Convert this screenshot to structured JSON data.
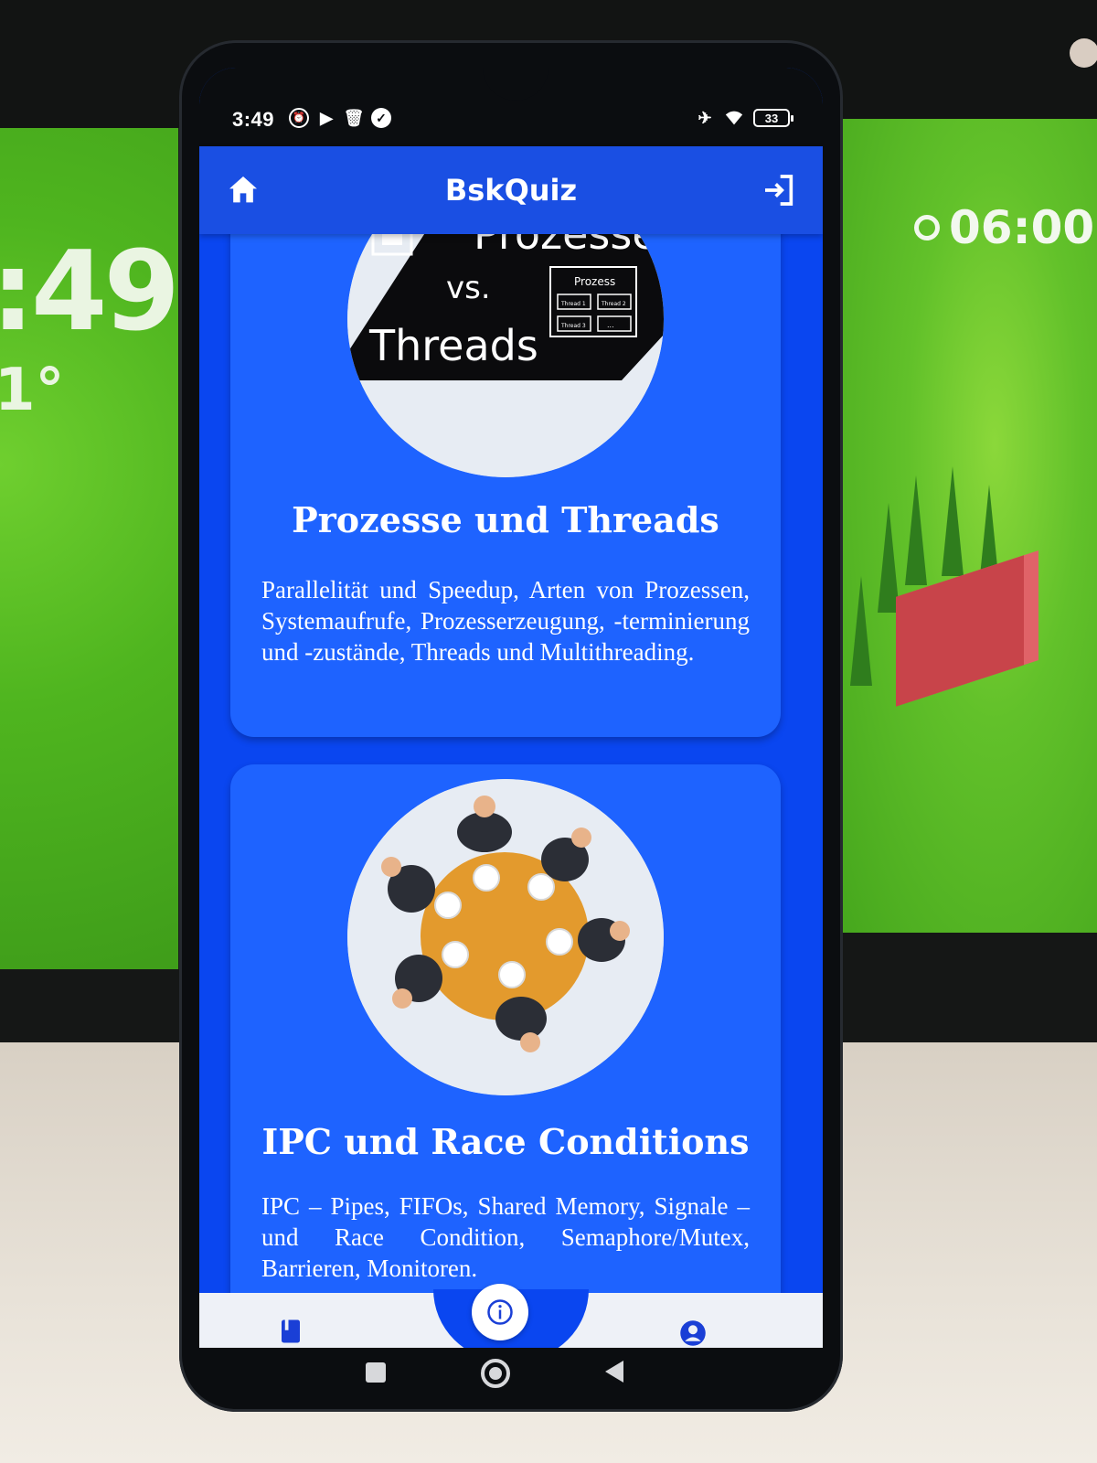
{
  "background": {
    "left_clock": ":49",
    "left_temperature": "1°",
    "right_alarm_time": "06:00"
  },
  "status_bar": {
    "time": "3:49",
    "battery_level": "33",
    "left_icons": [
      "alarm-icon",
      "play-store-icon",
      "trash-icon",
      "check-circle-icon"
    ],
    "right_icons": [
      "airplane-mode-icon",
      "wifi-icon",
      "battery-icon"
    ]
  },
  "app_bar": {
    "title": "BskQuiz",
    "left_icon": "home-icon",
    "right_icon": "logout-icon"
  },
  "cards": [
    {
      "title": "Prozesse und Threads",
      "description": "Parallelität und Speedup, Arten von Prozessen, Systemaufrufe, Prozesserzeugung, -terminierung und -zustände, Threads und Multithreading.",
      "image": {
        "heading": "Prozesse",
        "vs": "vs.",
        "subheading": "Threads",
        "box_title": "Prozess",
        "box_cells": [
          "Thread 1",
          "Thread 2",
          "Thread 3",
          "..."
        ]
      }
    },
    {
      "title": "IPC und Race Conditions",
      "description": "IPC – Pipes, FIFOs, Shared Memory, Signale – und Race Condition, Semaphore/Mutex, Barrieren, Monitoren.",
      "image": {
        "subject": "dining-philosophers-illustration"
      }
    }
  ],
  "bottom_nav": {
    "items": [
      "book-icon",
      "info-icon",
      "person-icon"
    ]
  },
  "system_nav": {
    "items": [
      "recents-square-icon",
      "home-circle-icon",
      "back-triangle-icon"
    ]
  },
  "colors": {
    "app_bar": "#1a4fe3",
    "screen_bg": "#0a46f0",
    "card_bg": "#1e63ff",
    "bottom_nav_bg": "#eef1f7",
    "icon_blue": "#1a3fd6"
  }
}
